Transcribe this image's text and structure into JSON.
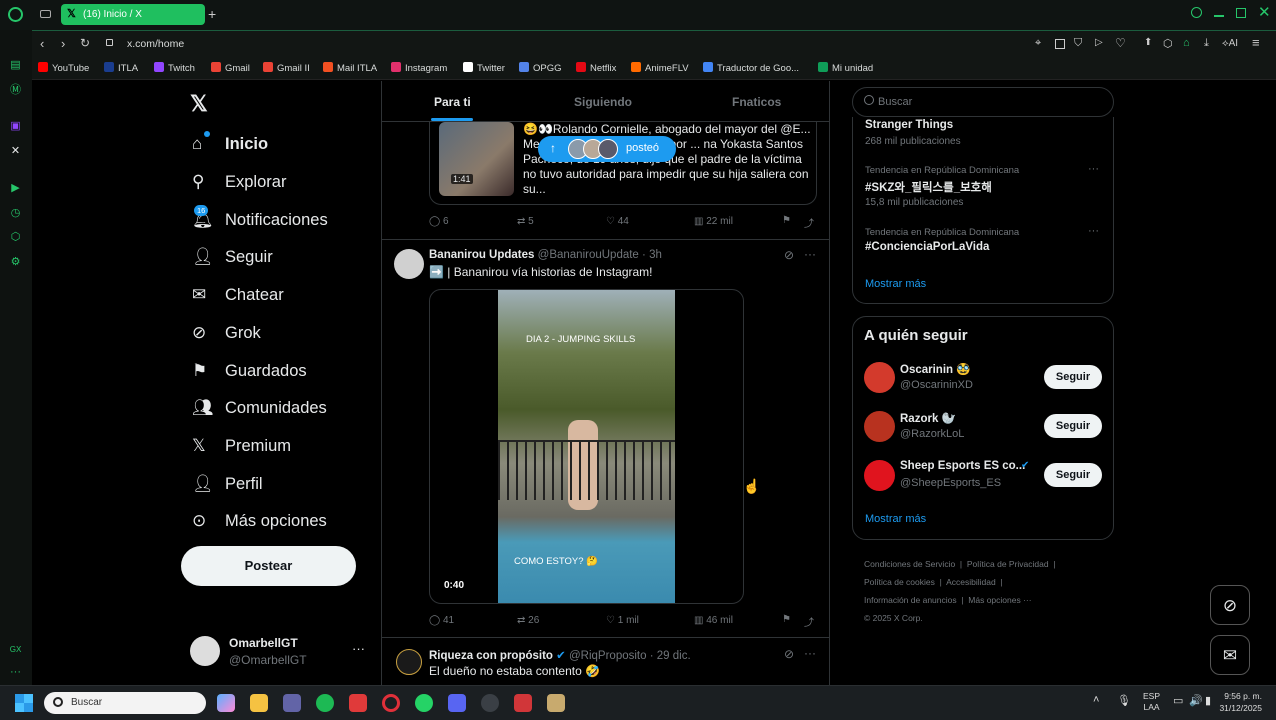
{
  "browser": {
    "tab_title": "(16) Inicio / X",
    "url": "x.com/home",
    "bookmarks": [
      {
        "label": "YouTube",
        "color": "#ff0000"
      },
      {
        "label": "ITLA",
        "color": "#1a3d8f"
      },
      {
        "label": "Twitch",
        "color": "#9146ff"
      },
      {
        "label": "Gmail",
        "color": "#ea4335"
      },
      {
        "label": "Gmail II",
        "color": "#ea4335"
      },
      {
        "label": "Mail ITLA",
        "color": "#f25022"
      },
      {
        "label": "Instagram",
        "color": "#e1306c"
      },
      {
        "label": "Twitter",
        "color": "#ffffff"
      },
      {
        "label": "OPGG",
        "color": "#5383e8"
      },
      {
        "label": "Netflix",
        "color": "#e50914"
      },
      {
        "label": "AnimeFLV",
        "color": "#ff6a00"
      },
      {
        "label": "Traductor de Goo...",
        "color": "#4285f4"
      },
      {
        "label": "Mi unidad",
        "color": "#0f9d58"
      }
    ],
    "ai_label": "AI"
  },
  "nav": {
    "items": [
      {
        "label": "Inicio",
        "icon": "home-icon"
      },
      {
        "label": "Explorar",
        "icon": "search-icon"
      },
      {
        "label": "Notificaciones",
        "icon": "bell-icon",
        "badge": "16"
      },
      {
        "label": "Seguir",
        "icon": "person-add-icon"
      },
      {
        "label": "Chatear",
        "icon": "mail-icon"
      },
      {
        "label": "Grok",
        "icon": "grok-icon"
      },
      {
        "label": "Guardados",
        "icon": "bookmark-icon"
      },
      {
        "label": "Comunidades",
        "icon": "communities-icon"
      },
      {
        "label": "Premium",
        "icon": "x-icon"
      },
      {
        "label": "Perfil",
        "icon": "profile-icon"
      },
      {
        "label": "Más opciones",
        "icon": "more-circle-icon"
      }
    ],
    "post_button": "Postear",
    "account_name": "OmarbellGT",
    "account_handle": "@OmarbellGT"
  },
  "feed": {
    "tabs": [
      "Para ti",
      "Siguiendo",
      "Fnaticos"
    ],
    "new_posts_pill": "posteó",
    "tweet1": {
      "text": "😆👀Rolando Cornielle, abogado del mayor del @E... Mesa Arismendy, señalado por ... na Yokasta Santos Pacheco, de 19 años, dijo que el padre de la víctima no tuvo autoridad para impedir que su hija saliera con su...",
      "video_duration": "1:41",
      "replies": "6",
      "reposts": "5",
      "likes": "44",
      "views": "22 mil"
    },
    "tweet2": {
      "author": "Bananirou Updates",
      "handle": "@BananirouUpdate",
      "time": "3h",
      "text": "➡️ | Bananirou vía historias de Instagram!",
      "video_top_text": "DIA 2 - JUMPING SKILLS",
      "video_bottom_text": "COMO ESTOY? 🤔",
      "video_duration": "0:40",
      "replies": "41",
      "reposts": "26",
      "likes": "1 mil",
      "views": "46 mil"
    },
    "tweet3": {
      "author": "Riqueza con propósito",
      "handle": "@RiqProposito",
      "time": "29 dic.",
      "text": "El dueño no estaba contento 🤣"
    }
  },
  "right": {
    "search_placeholder": "Buscar",
    "trends": [
      {
        "context": "",
        "title": "Stranger Things",
        "count": "268 mil publicaciones"
      },
      {
        "context": "Tendencia en República Dominicana",
        "title": "#SKZ와_필릭스를_보호해",
        "count": "15,8 mil publicaciones"
      },
      {
        "context": "Tendencia en República Dominicana",
        "title": "#ConcienciaPorLaVida",
        "count": ""
      }
    ],
    "show_more": "Mostrar más",
    "who_to_follow_title": "A quién seguir",
    "follow": [
      {
        "name": "Oscarinin 🥸",
        "handle": "@OscarininXD",
        "button": "Seguir",
        "avatar_color": "#d33a2c"
      },
      {
        "name": "Razork 🦭",
        "handle": "@RazorkLoL",
        "button": "Seguir",
        "avatar_color": "#b8321f"
      },
      {
        "name": "Sheep Esports ES co...",
        "handle": "@SheepEsports_ES",
        "button": "Seguir",
        "avatar_color": "#e0141e"
      }
    ],
    "show_more_2": "Mostrar más",
    "footer": [
      "Condiciones de Servicio",
      "Política de Privacidad",
      "Política de cookies",
      "Accesibilidad",
      "Información de anuncios",
      "Más opciones ···",
      "© 2025 X Corp."
    ]
  },
  "taskbar": {
    "search_placeholder": "Buscar",
    "lang": "ESP",
    "lang2": "LAA",
    "time": "9:56 p. m.",
    "date": "31/12/2025"
  }
}
